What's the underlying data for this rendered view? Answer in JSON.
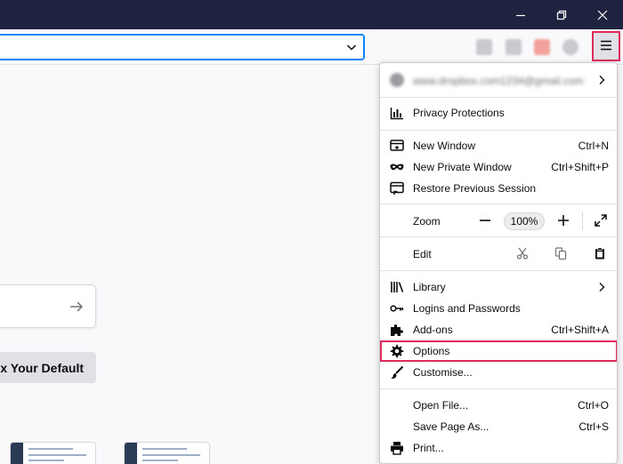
{
  "window_controls": {
    "minimize": "minimize-icon",
    "restore": "restore-icon",
    "close": "close-icon"
  },
  "toolbar": {
    "menu_icon": "hamburger-menu-icon"
  },
  "page": {
    "default_button_label": "ox Your Default"
  },
  "menu": {
    "account_email": "www.dropbox.com1234@gmail.com",
    "privacy": "Privacy Protections",
    "new_window": {
      "label": "New Window",
      "shortcut": "Ctrl+N"
    },
    "new_private_window": {
      "label": "New Private Window",
      "shortcut": "Ctrl+Shift+P"
    },
    "restore_session": "Restore Previous Session",
    "zoom": {
      "label": "Zoom",
      "value": "100%"
    },
    "edit": "Edit",
    "library": "Library",
    "logins": "Logins and Passwords",
    "addons": {
      "label": "Add-ons",
      "shortcut": "Ctrl+Shift+A"
    },
    "options": "Options",
    "customise": "Customise...",
    "open_file": {
      "label": "Open File...",
      "shortcut": "Ctrl+O"
    },
    "save_page": {
      "label": "Save Page As...",
      "shortcut": "Ctrl+S"
    },
    "print": "Print..."
  },
  "colors": {
    "titlebar": "#202340",
    "highlight": "#e02b5a",
    "url_focus": "#0a84ff"
  }
}
